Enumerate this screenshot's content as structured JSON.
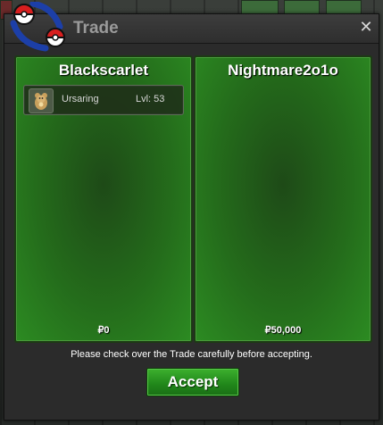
{
  "window": {
    "title": "Trade",
    "close_icon": "close-icon",
    "logo_icon": "pokeball-logo-icon"
  },
  "trade": {
    "left": {
      "player": "Blackscarlet",
      "items": [
        {
          "icon": "ursaring-icon",
          "name": "Ursaring",
          "level": "Lvl: 53"
        }
      ],
      "money": "₽0"
    },
    "right": {
      "player": "Nightmare2o1o",
      "items": [],
      "money": "₽50,000"
    },
    "notice": "Please check over the Trade carefully before accepting.",
    "accept_label": "Accept"
  },
  "colors": {
    "panel_green": "#246c1b",
    "accept_green": "#20861a",
    "title_gray": "#9a9a9a"
  }
}
